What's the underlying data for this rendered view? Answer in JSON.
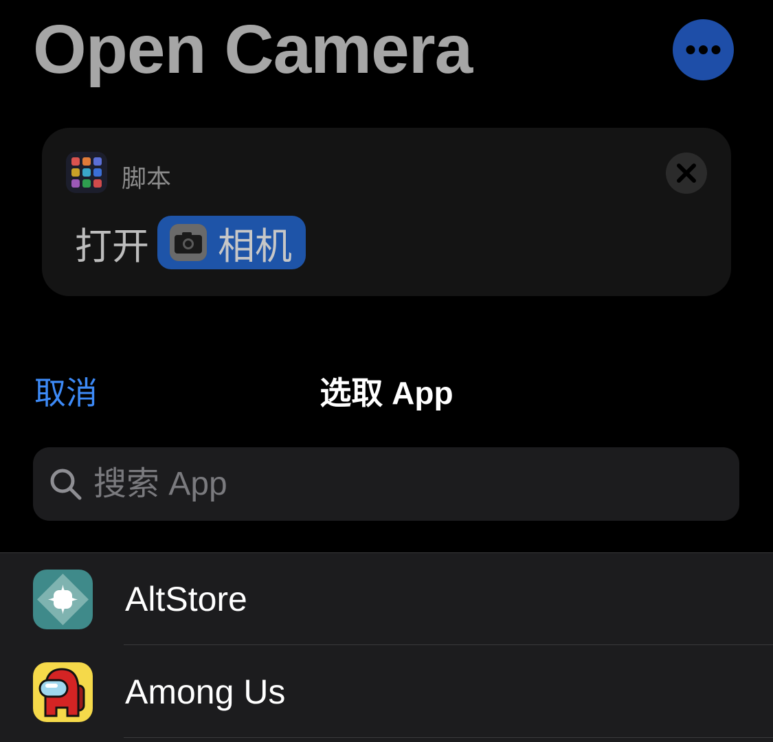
{
  "header": {
    "title": "Open Camera",
    "more_icon": "ellipsis-icon",
    "accent": "#1e4ea8"
  },
  "action": {
    "category_icon": "scripts-grid-icon",
    "category_label": "脚本",
    "remove_icon": "close-icon",
    "verb": "打开",
    "app_icon": "camera-icon",
    "app_label": "相机",
    "token_color": "#1e54a8"
  },
  "picker": {
    "cancel_label": "取消",
    "title": "选取 App",
    "cancel_color": "#3d8af7"
  },
  "search": {
    "icon": "search-icon",
    "placeholder": "搜索 App",
    "value": ""
  },
  "apps": [
    {
      "name": "AltStore",
      "icon": "altstore-icon"
    },
    {
      "name": "Among Us",
      "icon": "among-us-icon"
    }
  ]
}
